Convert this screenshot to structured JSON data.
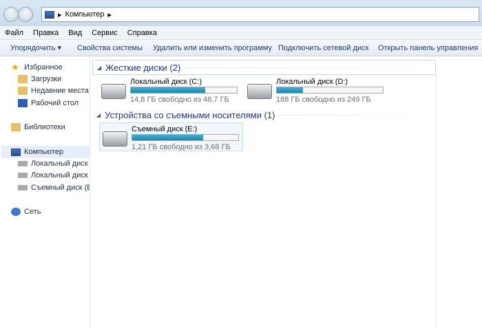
{
  "address": {
    "path": "Компьютер"
  },
  "menu": [
    "Файл",
    "Правка",
    "Вид",
    "Сервис",
    "Справка"
  ],
  "toolbar": {
    "organize": "Упорядочить ▾",
    "system_props": "Свойства системы",
    "uninstall": "Удалить или изменить программу",
    "map_drive": "Подключить сетевой диск",
    "control_panel": "Открыть панель управления"
  },
  "sidebar": {
    "favorites": "Избранное",
    "downloads": "Загрузки",
    "recent": "Недавние места",
    "desktop": "Рабочий стол",
    "libraries": "Библиотеки",
    "computer": "Компьютер",
    "disk_c": "Локальный диск (C",
    "disk_d": "Локальный диск (D",
    "disk_e": "Съемный диск (E:)",
    "network": "Сеть"
  },
  "groups": {
    "hdd": "Жесткие диски (2)",
    "removable": "Устройства со съемными носителями (1)"
  },
  "drives": [
    {
      "name": "Локальный диск (C:)",
      "free": "14,8 ГБ свободно из 48,7 ГБ",
      "used_fraction": 0.7
    },
    {
      "name": "Локальный диск (D:)",
      "free": "188 ГБ свободно из 249 ГБ",
      "used_fraction": 0.245
    },
    {
      "name": "Съемный диск (E:)",
      "free": "1,21 ГБ свободно из 3,68 ГБ",
      "used_fraction": 0.67
    }
  ]
}
